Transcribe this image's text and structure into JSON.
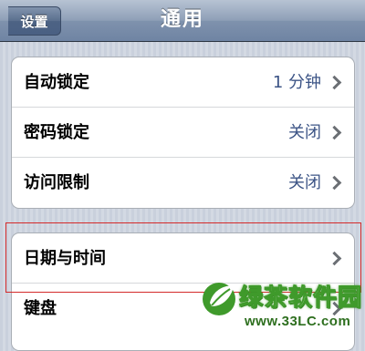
{
  "navbar": {
    "back_label": "设置",
    "title": "通用"
  },
  "group1": {
    "items": [
      {
        "label": "自动锁定",
        "value": "1 分钟"
      },
      {
        "label": "密码锁定",
        "value": "关闭"
      },
      {
        "label": "访问限制",
        "value": "关闭"
      }
    ]
  },
  "group2": {
    "items": [
      {
        "label": "日期与时间"
      },
      {
        "label": "键盘"
      }
    ]
  },
  "watermark": {
    "text": "绿茶软件园",
    "url": "www.33LC.com",
    "color": "#3f9a2b"
  },
  "colors": {
    "value_text": "#3c5486",
    "highlight": "#d42a2a"
  }
}
